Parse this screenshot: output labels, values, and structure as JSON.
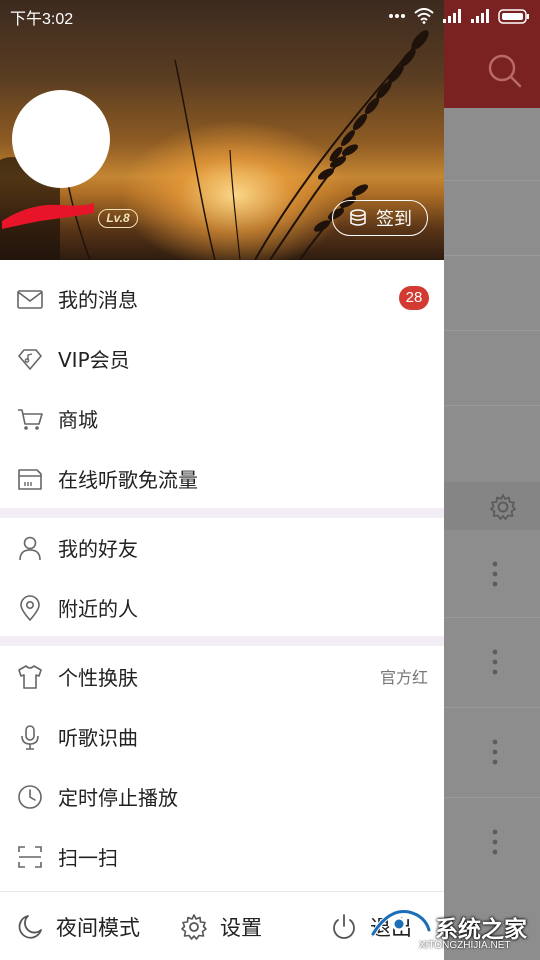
{
  "status_bar": {
    "time": "下午3:02"
  },
  "profile": {
    "level": "Lv.8",
    "sign_in_label": "签到"
  },
  "menu_group1": [
    {
      "label": "我的消息",
      "icon": "envelope-icon",
      "badge": "28"
    },
    {
      "label": "VIP会员",
      "icon": "diamond-icon"
    },
    {
      "label": "商城",
      "icon": "cart-icon"
    },
    {
      "label": "在线听歌免流量",
      "icon": "sim-card-icon"
    }
  ],
  "menu_group2": [
    {
      "label": "我的好友",
      "icon": "person-icon"
    },
    {
      "label": "附近的人",
      "icon": "location-pin-icon"
    }
  ],
  "menu_group3": [
    {
      "label": "个性换肤",
      "icon": "tshirt-icon",
      "right_text": "官方红"
    },
    {
      "label": "听歌识曲",
      "icon": "mic-icon"
    },
    {
      "label": "定时停止播放",
      "icon": "clock-icon"
    },
    {
      "label": "扫一扫",
      "icon": "scan-icon"
    }
  ],
  "bottom_bar": {
    "night_mode": "夜间模式",
    "settings": "设置",
    "exit": "退出"
  },
  "watermark": {
    "title": "系统之家",
    "url": "XITONGZHIJIA.NET"
  },
  "colors": {
    "accent_red": "#d33a31",
    "app_bar_red": "#7a2222",
    "overlay_gray": "#8d8d8d",
    "separator": "#f3eef5"
  }
}
